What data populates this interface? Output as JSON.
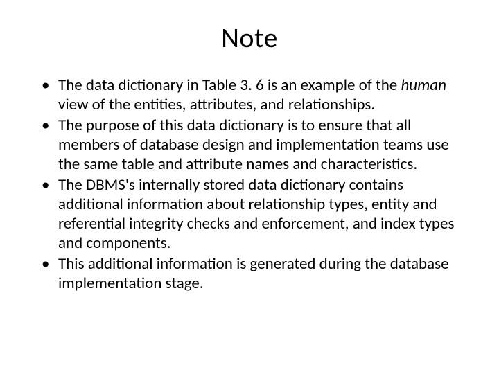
{
  "title": "Note",
  "bullets": [
    {
      "pre": "The data dictionary in Table 3. 6 is an example of the ",
      "em": "human",
      "post": " view of the entities, attributes, and relationships."
    },
    {
      "pre": "The purpose of this data dictionary is to ensure that all members of database design and implementation teams use the same table and attribute names and characteristics.",
      "em": "",
      "post": ""
    },
    {
      "pre": "The DBMS's internally stored data dictionary contains additional information about relationship types, entity and referential integrity checks and enforcement, and index types and components.",
      "em": "",
      "post": ""
    },
    {
      "pre": "This additional information is generated during the database implementation stage.",
      "em": "",
      "post": ""
    }
  ]
}
